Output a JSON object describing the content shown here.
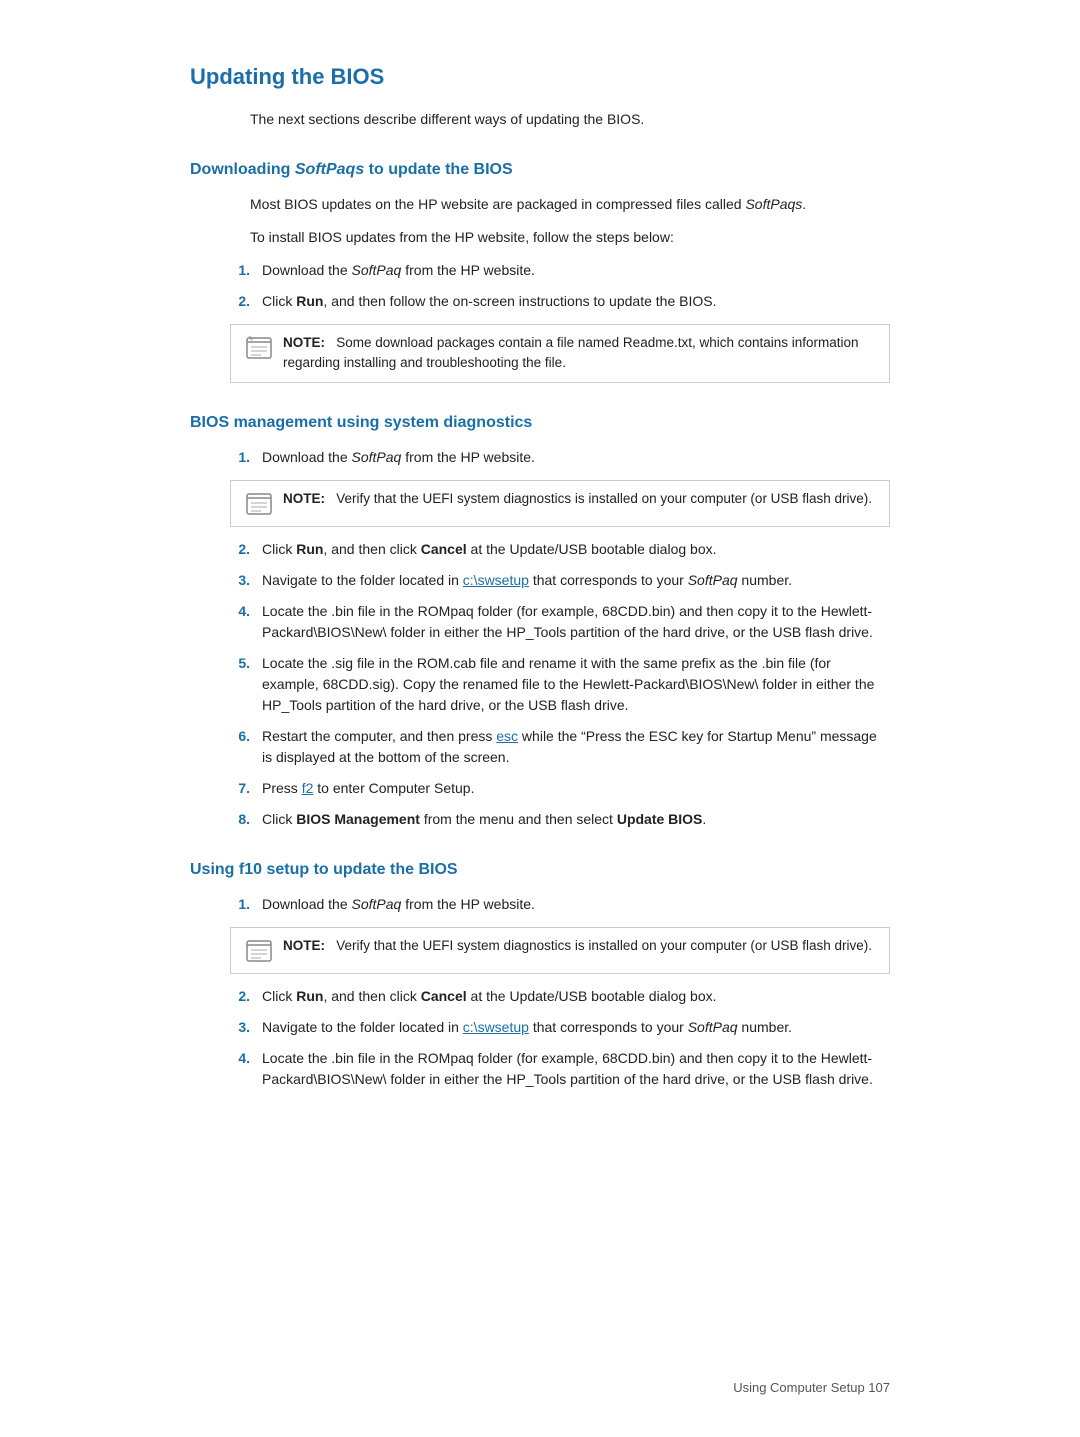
{
  "page": {
    "title": "Updating the BIOS",
    "footer": "Using Computer Setup   107",
    "intro": "The next sections describe different ways of updating the BIOS."
  },
  "sections": [
    {
      "id": "downloading-softpaqs",
      "title": "Downloading SoftPaqs to update the BIOS",
      "title_plain": "Downloading ",
      "title_italic": "SoftPaqs",
      "title_rest": " to update the BIOS",
      "paragraphs": [
        "Most BIOS updates on the HP website are packaged in compressed files called SoftPaqs.",
        "To install BIOS updates from the HP website, follow the steps below:"
      ],
      "steps": [
        {
          "num": "1.",
          "text": "Download the SoftPaq from the HP website.",
          "italic_word": "SoftPaq"
        },
        {
          "num": "2.",
          "text": "Click Run, and then follow the on-screen instructions to update the BIOS.",
          "bold_word": "Run"
        }
      ],
      "note": {
        "label": "NOTE:",
        "text": "Some download packages contain a file named Readme.txt, which contains information regarding installing and troubleshooting the file."
      }
    },
    {
      "id": "bios-management",
      "title": "BIOS management using system diagnostics",
      "steps": [
        {
          "num": "1.",
          "text": "Download the SoftPaq from the HP website.",
          "italic_word": "SoftPaq"
        }
      ],
      "note_after_step1": {
        "label": "NOTE:",
        "text": "Verify that the UEFI system diagnostics is installed on your computer (or USB flash drive)."
      },
      "steps2": [
        {
          "num": "2.",
          "html": "Click <strong>Run</strong>, and then click <strong>Cancel</strong> at the Update/USB bootable dialog box."
        },
        {
          "num": "3.",
          "html": "Navigate to the folder located in <a class=\"highlight-link\" href=\"#\">c:\\swsetup</a> that corresponds to your <em>SoftPaq</em> number."
        },
        {
          "num": "4.",
          "html": "Locate the .bin file in the ROMpaq folder (for example, 68CDD.bin) and then copy it to the Hewlett-Packard\\BIOS\\New\\ folder in either the HP_Tools partition of the hard drive, or the USB flash drive."
        },
        {
          "num": "5.",
          "html": "Locate the .sig file in the ROM.cab file and rename it with the same prefix as the .bin file (for example, 68CDD.sig). Copy the renamed file to the Hewlett-Packard\\BIOS\\New\\ folder in either the HP_Tools partition of the hard drive, or the USB flash drive."
        },
        {
          "num": "6.",
          "html": "Restart the computer, and then press <a class=\"highlight-link\" href=\"#\">esc</a> while the “Press the ESC key for Startup Menu” message is displayed at the bottom of the screen."
        },
        {
          "num": "7.",
          "html": "Press <a class=\"highlight-link\" href=\"#\">f2</a> to enter Computer Setup."
        },
        {
          "num": "8.",
          "html": "Click <strong>BIOS Management</strong> from the menu and then select <strong>Update BIOS</strong>."
        }
      ]
    },
    {
      "id": "using-f10-setup",
      "title": "Using f10 setup to update the BIOS",
      "steps": [
        {
          "num": "1.",
          "text": "Download the SoftPaq from the HP website.",
          "italic_word": "SoftPaq"
        }
      ],
      "note_after_step1": {
        "label": "NOTE:",
        "text": "Verify that the UEFI system diagnostics is installed on your computer (or USB flash drive)."
      },
      "steps2": [
        {
          "num": "2.",
          "html": "Click <strong>Run</strong>, and then click <strong>Cancel</strong> at the Update/USB bootable dialog box."
        },
        {
          "num": "3.",
          "html": "Navigate to the folder located in <a class=\"highlight-link\" href=\"#\">c:\\swsetup</a> that corresponds to your <em>SoftPaq</em> number."
        },
        {
          "num": "4.",
          "html": "Locate the .bin file in the ROMpaq folder (for example, 68CDD.bin) and then copy it to the Hewlett-Packard\\BIOS\\New\\ folder in either the HP_Tools partition of the hard drive, or the USB flash drive."
        }
      ]
    }
  ]
}
